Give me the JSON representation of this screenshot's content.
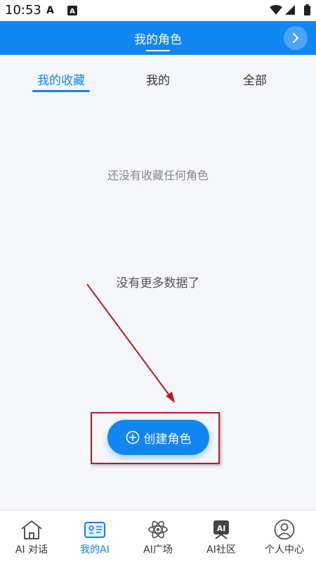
{
  "status_bar": {
    "time": "10:53",
    "icons": [
      "notification-a-icon",
      "keyboard-a-icon",
      "wifi-icon",
      "signal-icon",
      "battery-icon"
    ]
  },
  "header": {
    "title": "我的角色",
    "next_icon": "chevron-right-icon",
    "background_color": "#1186f0"
  },
  "tabs": [
    {
      "label": "我的收藏",
      "active": true
    },
    {
      "label": "我的",
      "active": false
    },
    {
      "label": "全部",
      "active": false
    }
  ],
  "content": {
    "empty_message": "还没有收藏任何角色",
    "no_more_message": "没有更多数据了"
  },
  "create_button": {
    "label": "创建角色",
    "icon": "plus-circle-icon"
  },
  "bottom_nav": [
    {
      "label": "AI 对话",
      "icon": "home-icon",
      "active": false
    },
    {
      "label": "我的AI",
      "icon": "robot-card-icon",
      "active": true
    },
    {
      "label": "AI广场",
      "icon": "atom-icon",
      "active": false
    },
    {
      "label": "AI社区",
      "icon": "ai-badge-icon",
      "active": false
    },
    {
      "label": "个人中心",
      "icon": "user-icon",
      "active": false
    }
  ],
  "colors": {
    "accent": "#1186f0",
    "annotation": "#b02023"
  }
}
